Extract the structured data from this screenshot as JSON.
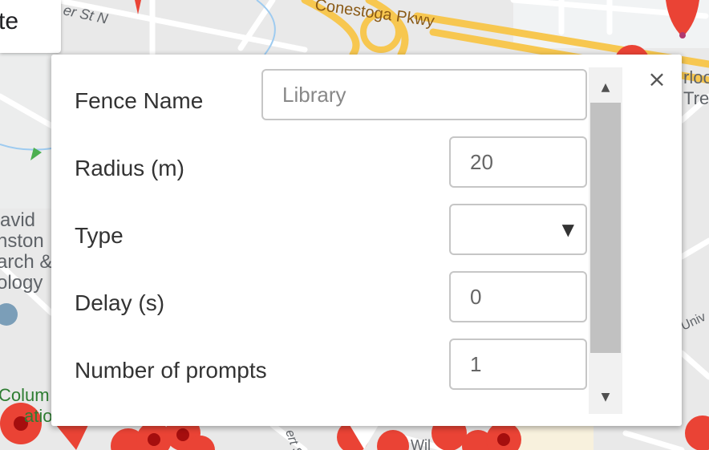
{
  "map": {
    "road_labels": {
      "conestoga": "Conestoga Pkwy",
      "street_top": "er St N",
      "left_place": [
        "avid",
        "nston",
        "arch &",
        "ology"
      ],
      "right_place": [
        "rloo",
        "Tre"
      ],
      "univ": "Univ",
      "colum": [
        "Colum",
        "atio"
      ],
      "bottom_street": "ert St",
      "bottom_wil": "Wil"
    },
    "marker_color": "#ea4335"
  },
  "top_left": {
    "text": "te"
  },
  "form": {
    "fence_name": {
      "label": "Fence Name",
      "placeholder": "Library",
      "value": ""
    },
    "radius": {
      "label": "Radius (m)",
      "placeholder": "20",
      "value": ""
    },
    "type": {
      "label": "Type",
      "selected": ""
    },
    "delay": {
      "label": "Delay (s)",
      "placeholder": "0",
      "value": ""
    },
    "prompts": {
      "label": "Number of prompts",
      "placeholder": "1",
      "value": ""
    }
  },
  "close_label": "×",
  "scroll": {
    "up": "▲",
    "down": "▼"
  },
  "select_arrow": "▼"
}
